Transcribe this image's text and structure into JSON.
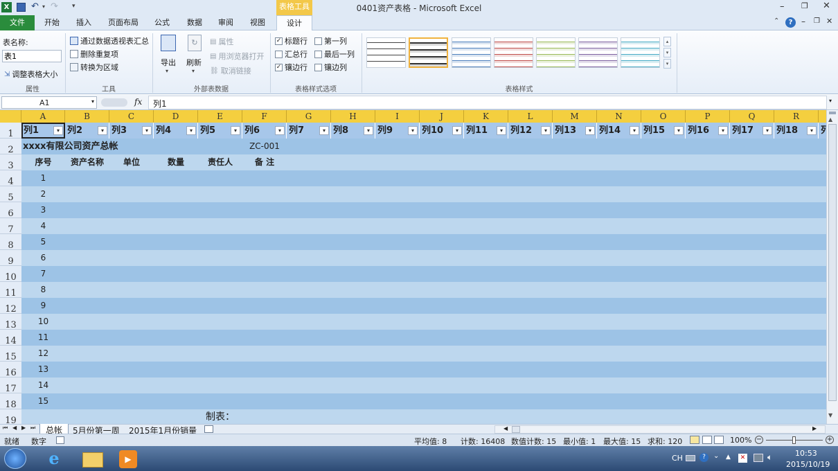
{
  "titlebar": {
    "window_title": "0401资产表格  -  Microsoft Excel",
    "tools_tab": "表格工具"
  },
  "ribbon_tabs": [
    {
      "label": "文件"
    },
    {
      "label": "开始"
    },
    {
      "label": "插入"
    },
    {
      "label": "页面布局"
    },
    {
      "label": "公式"
    },
    {
      "label": "数据"
    },
    {
      "label": "审阅"
    },
    {
      "label": "视图"
    },
    {
      "label": "设计"
    }
  ],
  "ribbon": {
    "properties": {
      "table_name_label": "表名称:",
      "table_name_value": "表1",
      "resize_label": "调整表格大小",
      "group": "属性"
    },
    "tools": {
      "pivot_label": "通过数据透视表汇总",
      "remove_dup_label": "删除重复项",
      "convert_label": "转换为区域",
      "group": "工具"
    },
    "external": {
      "export_label": "导出",
      "refresh_label": "刷新",
      "properties_label": "属性",
      "open_browser_label": "用浏览器打开",
      "unlink_label": "取消链接",
      "group": "外部表数据"
    },
    "style_options": {
      "header_row": "标题行",
      "total_row": "汇总行",
      "banded_rows": "镶边行",
      "first_col": "第一列",
      "last_col": "最后一列",
      "banded_cols": "镶边列",
      "group": "表格样式选项"
    },
    "table_styles": {
      "group": "表格样式"
    }
  },
  "formula_bar": {
    "name_box": "A1",
    "fx": "fx",
    "content": "列1"
  },
  "columns": [
    "A",
    "B",
    "C",
    "D",
    "E",
    "F",
    "G",
    "H",
    "I",
    "J",
    "K",
    "L",
    "M",
    "N",
    "O",
    "P",
    "Q",
    "R"
  ],
  "table_headers": [
    "列1",
    "列2",
    "列3",
    "列4",
    "列5",
    "列6",
    "列7",
    "列8",
    "列9",
    "列10",
    "列11",
    "列12",
    "列13",
    "列14",
    "列15",
    "列16",
    "列17",
    "列18",
    "列"
  ],
  "row_numbers": [
    "1",
    "2",
    "3",
    "4",
    "5",
    "6",
    "7",
    "8",
    "9",
    "10",
    "11",
    "12",
    "13",
    "14",
    "15",
    "16",
    "17",
    "18",
    "19"
  ],
  "sheet": {
    "company_title": "xxxx有限公司资产总帐",
    "code": "ZC-001",
    "col_labels": [
      "序号",
      "资产名称",
      "单位",
      "数量",
      "责任人",
      "备  注"
    ],
    "seq": [
      "1",
      "2",
      "3",
      "4",
      "5",
      "6",
      "7",
      "8",
      "9",
      "10",
      "11",
      "12",
      "13",
      "14",
      "15"
    ],
    "maker_label": "制表："
  },
  "sheet_tabs": [
    "总帐",
    "5月份第一周",
    "2015年1月份销量"
  ],
  "status": {
    "ready": "就绪",
    "num": "数字",
    "average": "平均值: 8",
    "count": "计数: 16408",
    "numcount": "数值计数: 15",
    "min": "最小值: 1",
    "max": "最大值: 15",
    "sum": "求和: 120",
    "zoom": "100%"
  },
  "taskbar": {
    "ime": "CH",
    "time": "10:53",
    "date": "2015/10/19"
  },
  "colors": {
    "header_yellow": "#f4cf3f",
    "band_dark": "#9dc3e6",
    "band_light": "#bdd7ee",
    "file_tab": "#2a8c3c"
  }
}
